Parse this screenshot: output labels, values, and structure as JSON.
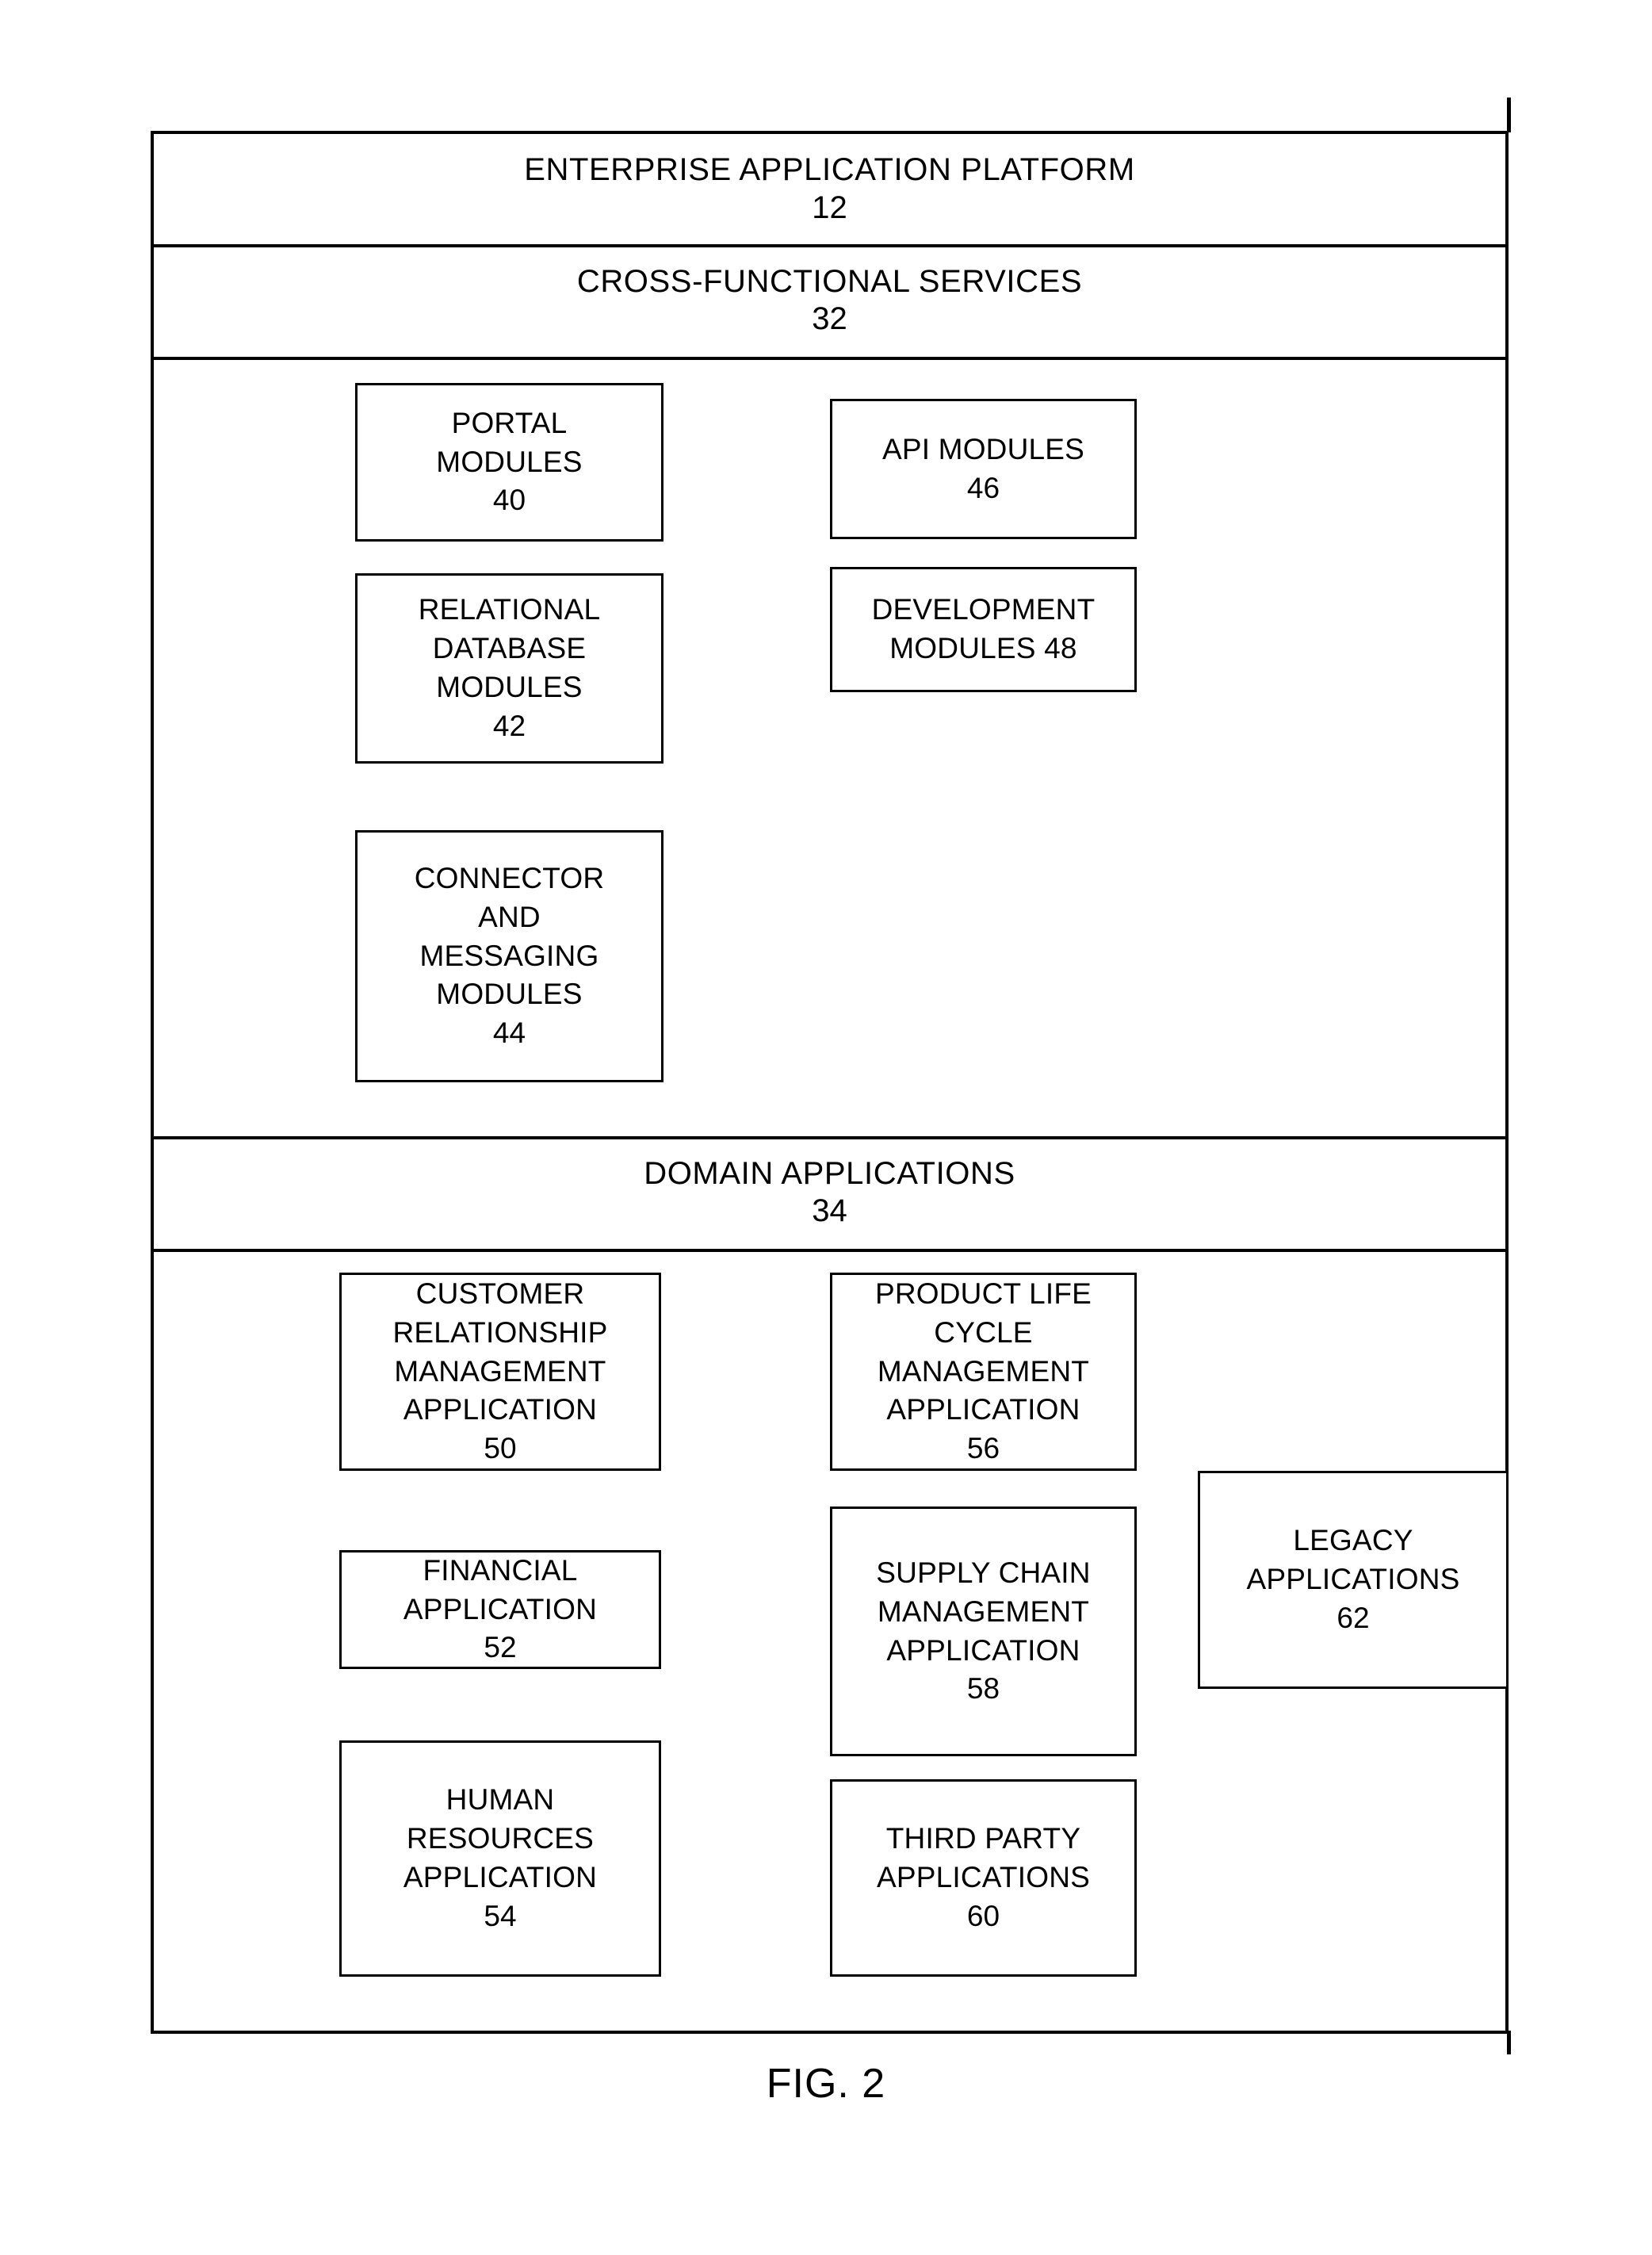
{
  "figure": {
    "caption": "FIG. 2"
  },
  "bands": [
    {
      "id": "enterprise-application-platform",
      "title": "ENTERPRISE APPLICATION PLATFORM",
      "ref": "12"
    },
    {
      "id": "cross-functional-services",
      "title": "CROSS-FUNCTIONAL SERVICES",
      "ref": "32"
    },
    {
      "id": "domain-applications",
      "title": "DOMAIN APPLICATIONS",
      "ref": "34"
    }
  ],
  "cross_functional_services": {
    "modules": [
      {
        "id": "portal-modules",
        "label": "PORTAL\nMODULES",
        "ref": "40"
      },
      {
        "id": "relational-database-modules",
        "label": "RELATIONAL\nDATABASE\nMODULES",
        "ref": "42"
      },
      {
        "id": "connector-and-messaging-modules",
        "label": "CONNECTOR\nAND\nMESSAGING\nMODULES",
        "ref": "44"
      },
      {
        "id": "api-modules",
        "label": "API MODULES",
        "ref": "46"
      },
      {
        "id": "development-modules",
        "label": "DEVELOPMENT\nMODULES 48",
        "ref": ""
      }
    ]
  },
  "domain_applications": {
    "applications": [
      {
        "id": "customer-relationship-management-application",
        "label": "CUSTOMER\nRELATIONSHIP\nMANAGEMENT\nAPPLICATION",
        "ref": "50"
      },
      {
        "id": "financial-application",
        "label": "FINANCIAL\nAPPLICATION",
        "ref": "52"
      },
      {
        "id": "human-resources-application",
        "label": "HUMAN\nRESOURCES\nAPPLICATION",
        "ref": "54"
      },
      {
        "id": "product-life-cycle-management-application",
        "label": "PRODUCT LIFE\nCYCLE\nMANAGEMENT\nAPPLICATION",
        "ref": "56"
      },
      {
        "id": "supply-chain-management-application",
        "label": "SUPPLY CHAIN\nMANAGEMENT\nAPPLICATION",
        "ref": "58"
      },
      {
        "id": "third-party-applications",
        "label": "THIRD PARTY\nAPPLICATIONS",
        "ref": "60"
      },
      {
        "id": "legacy-applications",
        "label": "LEGACY\nAPPLICATIONS",
        "ref": "62"
      }
    ]
  },
  "colors": {
    "ink": "#000000",
    "paper": "#ffffff"
  }
}
